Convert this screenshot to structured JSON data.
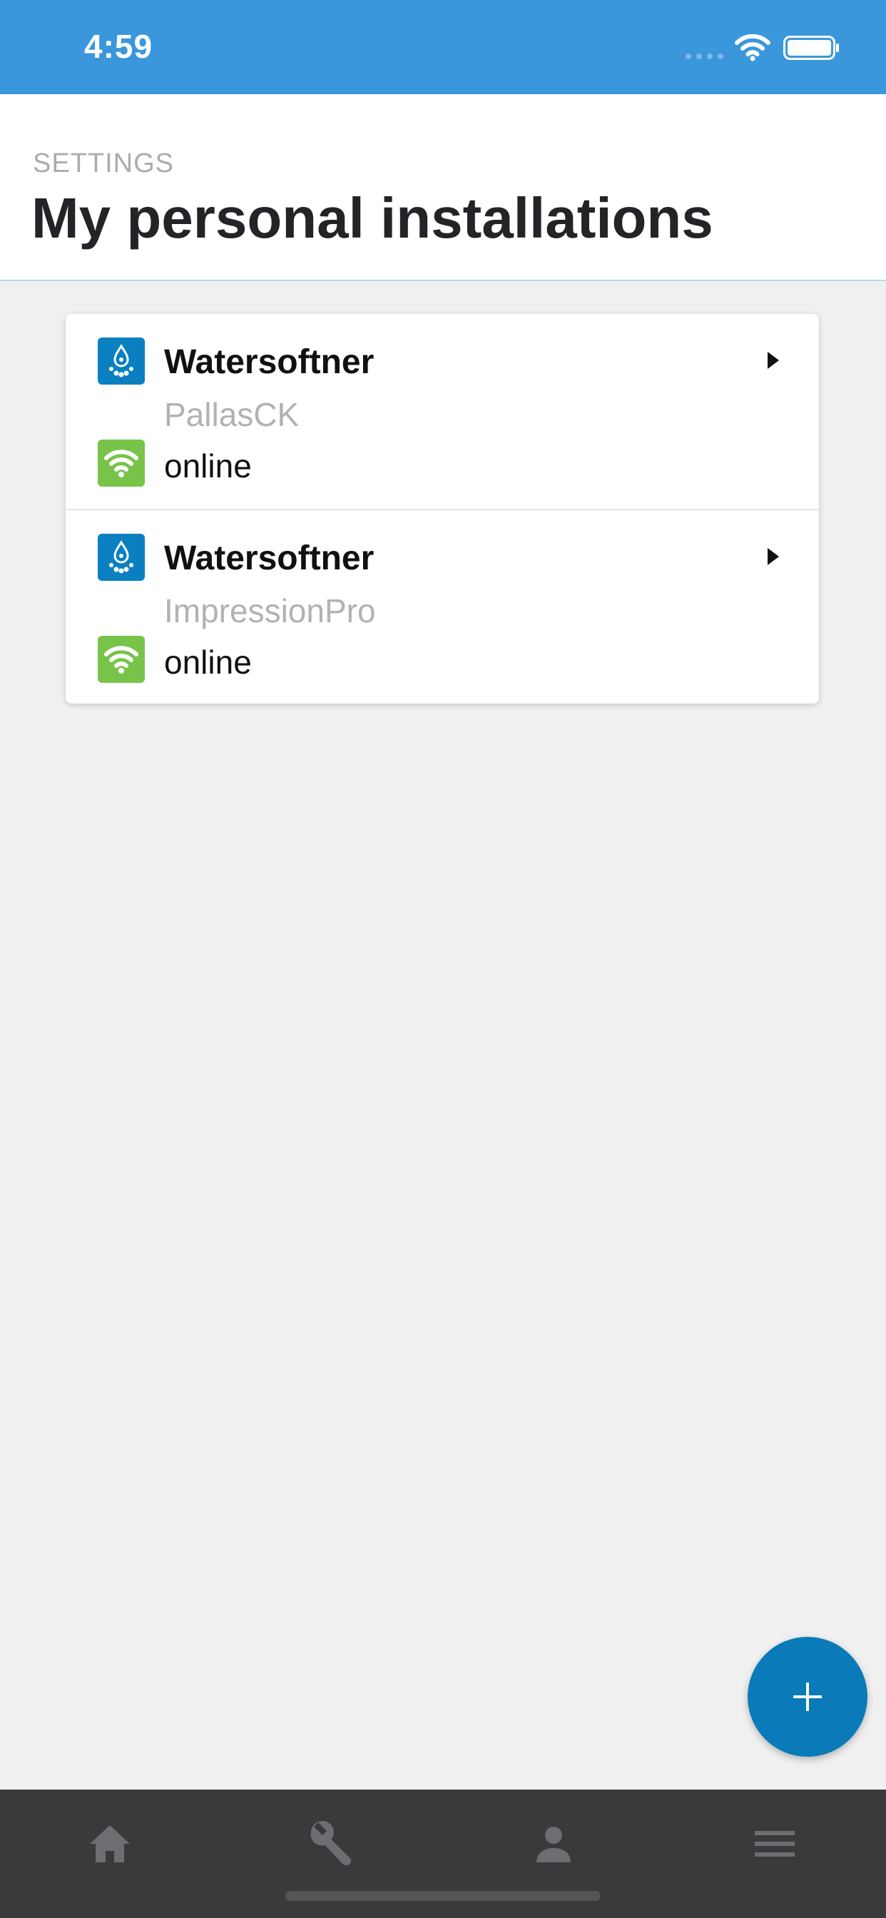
{
  "status_bar": {
    "time": "4:59",
    "background": "#3a97db"
  },
  "header": {
    "eyebrow": "SETTINGS",
    "title": "My personal installations"
  },
  "installations": [
    {
      "name": "Watersoftner",
      "model": "PallasCK",
      "status": "online",
      "device_icon": "water-drop-icon",
      "status_icon": "wifi-icon"
    },
    {
      "name": "Watersoftner",
      "model": "ImpressionPro",
      "status": "online",
      "device_icon": "water-drop-icon",
      "status_icon": "wifi-icon"
    }
  ],
  "fab": {
    "icon": "plus-icon",
    "color": "#0a7ab8"
  },
  "bottom_nav": {
    "items": [
      {
        "icon": "home-icon"
      },
      {
        "icon": "wrench-icon"
      },
      {
        "icon": "person-icon"
      },
      {
        "icon": "menu-icon"
      }
    ],
    "background": "#3a3a3c"
  },
  "colors": {
    "online": "#78c34a",
    "device": "#0a80c0",
    "accent": "#3a97db"
  }
}
